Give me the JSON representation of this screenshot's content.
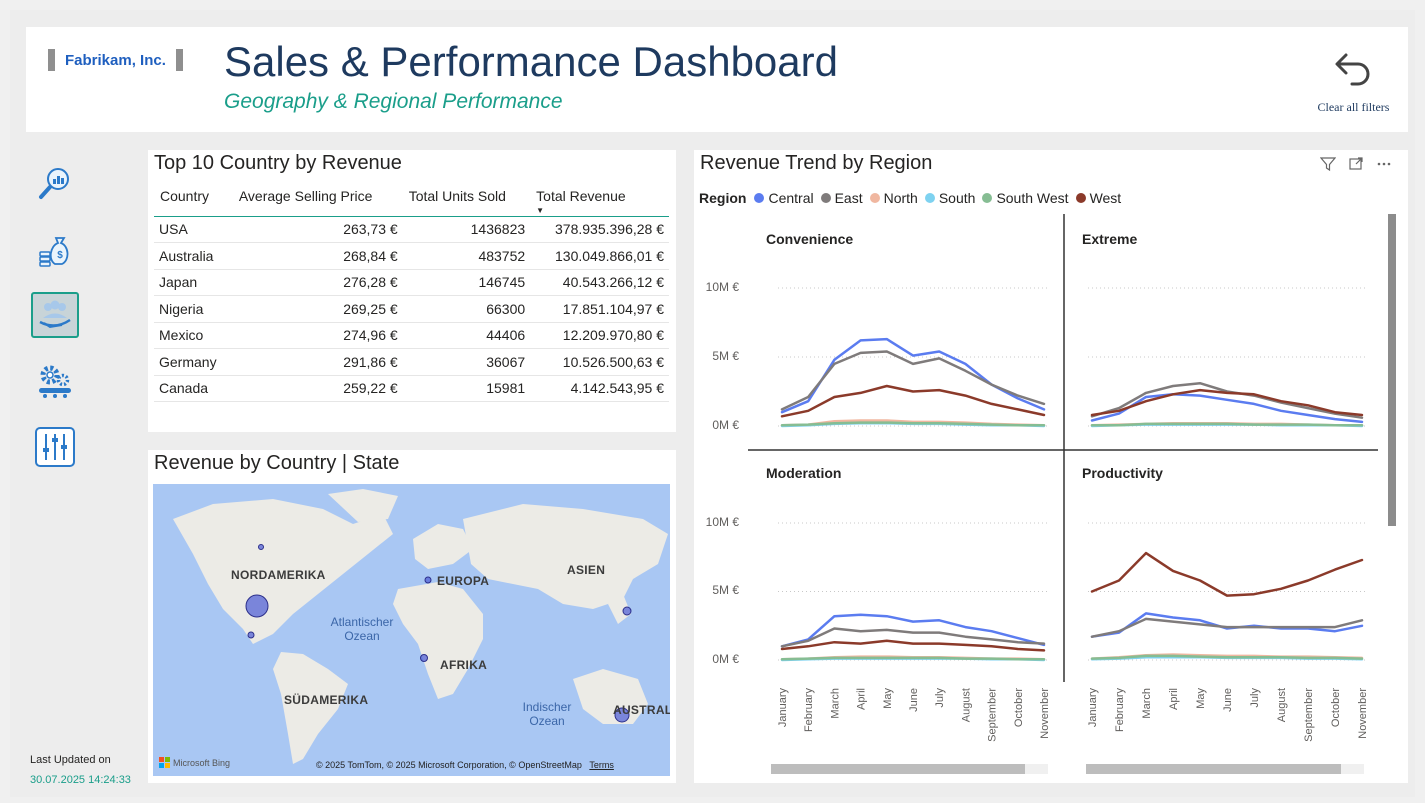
{
  "header": {
    "logo": "Fabrikam, Inc.",
    "title": "Sales & Performance Dashboard",
    "subtitle": "Geography & Regional Performance",
    "clear_filters": "Clear all filters"
  },
  "nav": {
    "items": [
      {
        "icon": "analytics-search-icon",
        "active": false
      },
      {
        "icon": "money-bag-icon",
        "active": false
      },
      {
        "icon": "customer-group-icon",
        "active": true
      },
      {
        "icon": "operations-gears-icon",
        "active": false
      },
      {
        "icon": "filter-sliders-icon",
        "active": false
      }
    ]
  },
  "updated": {
    "label": "Last Updated on",
    "value": "30.07.2025 14:24:33"
  },
  "top10": {
    "title": "Top 10 Country by Revenue",
    "columns": [
      "Country",
      "Average Selling Price",
      "Total Units Sold",
      "Total Revenue"
    ],
    "rows": [
      [
        "USA",
        "263,73 €",
        "1436823",
        "378.935.396,28 €"
      ],
      [
        "Australia",
        "268,84 €",
        "483752",
        "130.049.866,01 €"
      ],
      [
        "Japan",
        "276,28 €",
        "146745",
        "40.543.266,12 €"
      ],
      [
        "Nigeria",
        "269,25 €",
        "66300",
        "17.851.104,97 €"
      ],
      [
        "Mexico",
        "274,96 €",
        "44406",
        "12.209.970,80 €"
      ],
      [
        "Germany",
        "291,86 €",
        "36067",
        "10.526.500,63 €"
      ],
      [
        "Canada",
        "259,22 €",
        "15981",
        "4.142.543,95 €"
      ]
    ]
  },
  "map": {
    "title": "Revenue by Country | State",
    "labels": {
      "na": "NORDAMERIKA",
      "eu": "EUROPA",
      "as": "ASIEN",
      "af": "AFRIKA",
      "sa": "SÜDAMERIKA",
      "au": "AUSTRAL",
      "atl": "Atlantischer Ozean",
      "ind": "Indischer Ozean"
    },
    "bing": "Microsoft Bing",
    "copyright": "© 2025 TomTom, © 2025 Microsoft Corporation, © OpenStreetMap",
    "terms": "Terms"
  },
  "trend": {
    "title": "Revenue Trend by Region",
    "legend_title": "Region",
    "panels": [
      "Convenience",
      "Extreme",
      "Moderation",
      "Productivity"
    ],
    "yticks": [
      "10M €",
      "5M €",
      "0M €"
    ]
  },
  "colors": {
    "Central": "#5b7cf0",
    "East": "#7f7b7b",
    "North": "#f0b7a0",
    "South": "#7ed2f0",
    "South West": "#86bd93",
    "West": "#8b3a2a",
    "accent": "#1a9e8a",
    "navy": "#1e3a5f"
  },
  "chart_data": {
    "type": "line",
    "title": "Revenue Trend by Region",
    "x": [
      "January",
      "February",
      "March",
      "April",
      "May",
      "June",
      "July",
      "August",
      "September",
      "October",
      "November"
    ],
    "ylim": [
      0,
      10000000
    ],
    "legend_position": "top",
    "grid": true,
    "facets": [
      {
        "name": "Convenience",
        "series": [
          {
            "name": "Central",
            "values": [
              1000000,
              1800000,
              4800000,
              6200000,
              6300000,
              5100000,
              5400000,
              4500000,
              3000000,
              2000000,
              1200000
            ]
          },
          {
            "name": "East",
            "values": [
              1200000,
              2100000,
              4500000,
              5300000,
              5400000,
              4500000,
              4900000,
              4000000,
              3000000,
              2200000,
              1600000
            ]
          },
          {
            "name": "North",
            "values": [
              50000,
              100000,
              350000,
              400000,
              400000,
              300000,
              300000,
              250000,
              150000,
              100000,
              50000
            ]
          },
          {
            "name": "South",
            "values": [
              0,
              50000,
              150000,
              200000,
              200000,
              150000,
              150000,
              100000,
              50000,
              50000,
              0
            ]
          },
          {
            "name": "South West",
            "values": [
              50000,
              100000,
              200000,
              250000,
              250000,
              200000,
              200000,
              150000,
              100000,
              50000,
              50000
            ]
          },
          {
            "name": "West",
            "values": [
              700000,
              1100000,
              2100000,
              2400000,
              2900000,
              2500000,
              2600000,
              2200000,
              1600000,
              1200000,
              800000
            ]
          }
        ]
      },
      {
        "name": "Extreme",
        "series": [
          {
            "name": "Central",
            "values": [
              400000,
              900000,
              2100000,
              2300000,
              2200000,
              1900000,
              1600000,
              1100000,
              800000,
              500000,
              300000
            ]
          },
          {
            "name": "East",
            "values": [
              700000,
              1300000,
              2400000,
              2900000,
              3100000,
              2500000,
              2200000,
              1700000,
              1300000,
              900000,
              600000
            ]
          },
          {
            "name": "North",
            "values": [
              50000,
              100000,
              150000,
              200000,
              200000,
              200000,
              150000,
              150000,
              100000,
              50000,
              50000
            ]
          },
          {
            "name": "South",
            "values": [
              0,
              50000,
              100000,
              100000,
              100000,
              100000,
              100000,
              50000,
              50000,
              50000,
              0
            ]
          },
          {
            "name": "South West",
            "values": [
              50000,
              50000,
              150000,
              150000,
              150000,
              150000,
              100000,
              100000,
              100000,
              50000,
              50000
            ]
          },
          {
            "name": "West",
            "values": [
              800000,
              1100000,
              1800000,
              2300000,
              2600000,
              2400000,
              2300000,
              1800000,
              1500000,
              1000000,
              800000
            ]
          }
        ]
      },
      {
        "name": "Moderation",
        "series": [
          {
            "name": "Central",
            "values": [
              1000000,
              1500000,
              3200000,
              3300000,
              3200000,
              2800000,
              2900000,
              2400000,
              2100000,
              1600000,
              1100000
            ]
          },
          {
            "name": "East",
            "values": [
              1000000,
              1400000,
              2300000,
              2100000,
              2200000,
              2000000,
              2000000,
              1700000,
              1500000,
              1300000,
              1200000
            ]
          },
          {
            "name": "North",
            "values": [
              50000,
              100000,
              200000,
              250000,
              250000,
              200000,
              200000,
              150000,
              100000,
              100000,
              50000
            ]
          },
          {
            "name": "South",
            "values": [
              0,
              50000,
              100000,
              100000,
              100000,
              100000,
              100000,
              100000,
              50000,
              50000,
              0
            ]
          },
          {
            "name": "South West",
            "values": [
              50000,
              100000,
              150000,
              150000,
              150000,
              150000,
              150000,
              100000,
              100000,
              50000,
              50000
            ]
          },
          {
            "name": "West",
            "values": [
              800000,
              1000000,
              1300000,
              1200000,
              1400000,
              1200000,
              1200000,
              1100000,
              1000000,
              800000,
              700000
            ]
          }
        ]
      },
      {
        "name": "Productivity",
        "series": [
          {
            "name": "Central",
            "values": [
              1700000,
              2000000,
              3400000,
              3100000,
              2900000,
              2300000,
              2500000,
              2300000,
              2300000,
              2100000,
              2500000
            ]
          },
          {
            "name": "East",
            "values": [
              1700000,
              2100000,
              3000000,
              2800000,
              2600000,
              2400000,
              2400000,
              2400000,
              2400000,
              2400000,
              2900000
            ]
          },
          {
            "name": "North",
            "values": [
              100000,
              200000,
              350000,
              400000,
              350000,
              300000,
              300000,
              250000,
              250000,
              200000,
              150000
            ]
          },
          {
            "name": "South",
            "values": [
              50000,
              100000,
              200000,
              200000,
              200000,
              150000,
              150000,
              150000,
              100000,
              100000,
              50000
            ]
          },
          {
            "name": "South West",
            "values": [
              100000,
              150000,
              300000,
              300000,
              250000,
              200000,
              200000,
              200000,
              150000,
              150000,
              100000
            ]
          },
          {
            "name": "West",
            "values": [
              5000000,
              5800000,
              7800000,
              6500000,
              5800000,
              4700000,
              4800000,
              5200000,
              5800000,
              6600000,
              7300000
            ]
          }
        ]
      }
    ]
  }
}
